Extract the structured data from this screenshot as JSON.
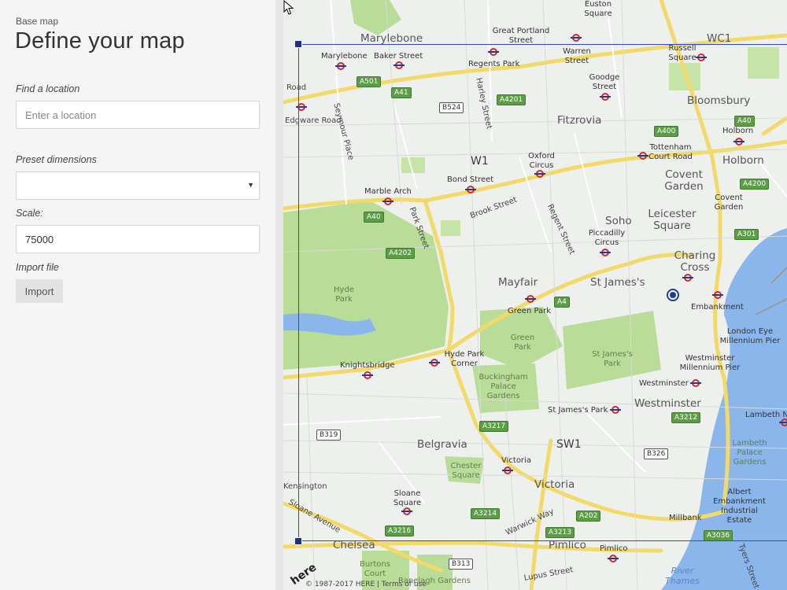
{
  "panel": {
    "breadcrumb": "Base map",
    "title": "Define your map",
    "find_label": "Find a location",
    "find_placeholder": "Enter a location",
    "preset_label": "Preset dimensions",
    "preset_value": "",
    "scale_label": "Scale:",
    "scale_value": "75000",
    "import_label": "Import file",
    "import_button": "Import"
  },
  "map": {
    "areas": [
      "Marylebone",
      "WC1",
      "Bloomsbury",
      "Fitzrovia",
      "W1",
      "Holborn",
      "Covent Garden",
      "Soho",
      "Leicester Square",
      "Charing Cross",
      "Mayfair",
      "St James's",
      "Westminster",
      "SW1",
      "Belgravia",
      "Victoria",
      "Chelsea",
      "Pimlico"
    ],
    "stations": [
      "Euston Square",
      "Great Portland Street",
      "Warren Street",
      "Russell Square",
      "Marylebone",
      "Baker Street",
      "Regents Park",
      "Goodge Street",
      "Holborn",
      "Tottenham Court Road",
      "Oxford Circus",
      "Bond Street",
      "Marble Arch",
      "Covent Garden",
      "Piccadilly Circus",
      "Green Park",
      "Embankment",
      "Hyde Park Corner",
      "Knightsbridge",
      "Westminster",
      "St James's Park",
      "Sloane Square",
      "Victoria",
      "Pimlico",
      "Millbank",
      "Lambeth North",
      "London Eye Millennium Pier",
      "Westminster Millennium Pier"
    ],
    "parks": [
      "Hyde Park",
      "Green Park",
      "St James's Park",
      "Buckingham Palace Gardens",
      "Chester Square",
      "Lambeth Palace Gardens",
      "Burtons Court",
      "Ranelagh Gardens",
      "Albert Embankment Industrial Estate"
    ],
    "streets": [
      "Seymour Place",
      "Park Street",
      "Brook Street",
      "Harley Street",
      "Regent Street",
      "Sloane Avenue",
      "Warwick Way",
      "Lupus Street",
      "Tyers Street",
      "Edgware Road",
      "Kensington",
      "Road"
    ],
    "road_badges": [
      "A501",
      "A41",
      "B524",
      "A4201",
      "A400",
      "A40",
      "A4200",
      "A40",
      "A4202",
      "A4",
      "A301",
      "A3212",
      "B319",
      "A3217",
      "B326",
      "A3214",
      "A202",
      "A3216",
      "A3213",
      "A3036",
      "B313"
    ],
    "river": "River Thames",
    "attribution": "© 1987-2017 HERE | Terms of use",
    "logo": "here"
  }
}
